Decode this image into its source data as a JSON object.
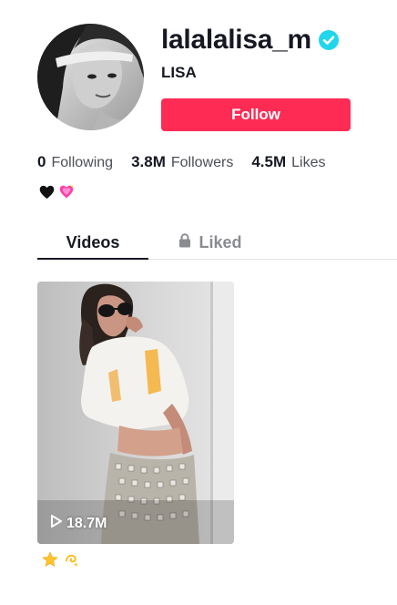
{
  "profile": {
    "username": "lalalalisa_m",
    "verified": true,
    "nickname": "LISA",
    "follow_label": "Follow",
    "avatar_icon": "avatar-photo"
  },
  "stats": {
    "following": {
      "value": "0",
      "label": "Following"
    },
    "followers": {
      "value": "3.8M",
      "label": "Followers"
    },
    "likes": {
      "value": "4.5M",
      "label": "Likes"
    }
  },
  "bio": {
    "emojis": [
      "black-heart",
      "sparkling-heart"
    ]
  },
  "tabs": [
    {
      "label": "Videos",
      "active": true
    },
    {
      "label": "Liked",
      "active": false,
      "icon": "lock-icon"
    }
  ],
  "videos": [
    {
      "views": "18.7M",
      "caption_emojis": [
        "star",
        "dizzy"
      ]
    }
  ],
  "colors": {
    "accent": "#fe2c55",
    "verified": "#20d5ec",
    "text_primary": "#161823",
    "text_secondary": "#4d4f57",
    "tab_inactive": "#8a8b91"
  }
}
